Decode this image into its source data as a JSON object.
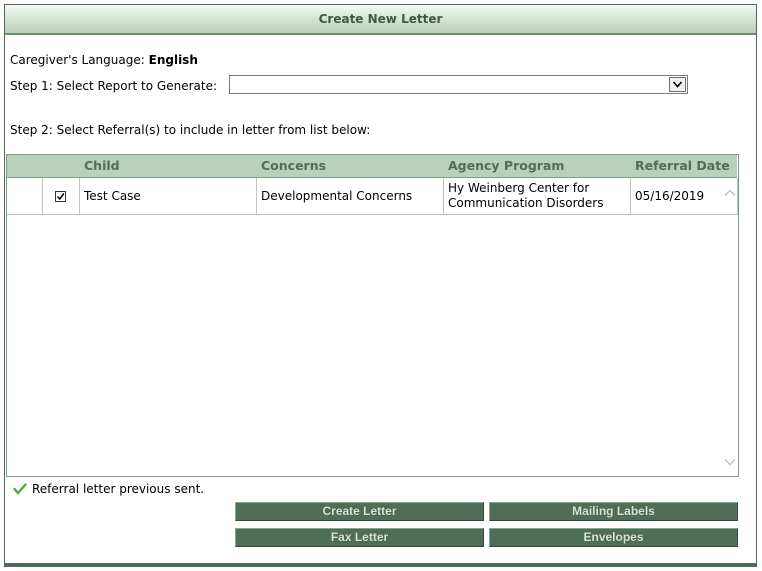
{
  "window": {
    "title": "Create New Letter"
  },
  "language": {
    "label": "Caregiver's Language:",
    "value": "English"
  },
  "step1": {
    "label": "Step 1: Select Report to Generate:",
    "selected": ""
  },
  "step2": {
    "label": "Step 2: Select Referral(s) to include in letter from list below:"
  },
  "grid": {
    "headers": {
      "child": "Child",
      "concerns": "Concerns",
      "agency": "Agency Program",
      "date": "Referral Date"
    },
    "rows": [
      {
        "checked": true,
        "child": "Test Case",
        "concerns": "Developmental Concerns",
        "agency_line1": "Hy Weinberg Center for",
        "agency_line2": "Communication Disorders",
        "date": "05/16/2019"
      }
    ]
  },
  "legend": {
    "text": "Referral letter previous sent.",
    "icon": "green-checkmark-icon"
  },
  "buttons": {
    "create_letter": "Create Letter",
    "mailing_labels": "Mailing Labels",
    "fax_letter": "Fax Letter",
    "envelopes": "Envelopes"
  },
  "colors": {
    "accent": "#4f6e58",
    "header_bg": "#b9d1bb",
    "header_text": "#4e7055"
  }
}
